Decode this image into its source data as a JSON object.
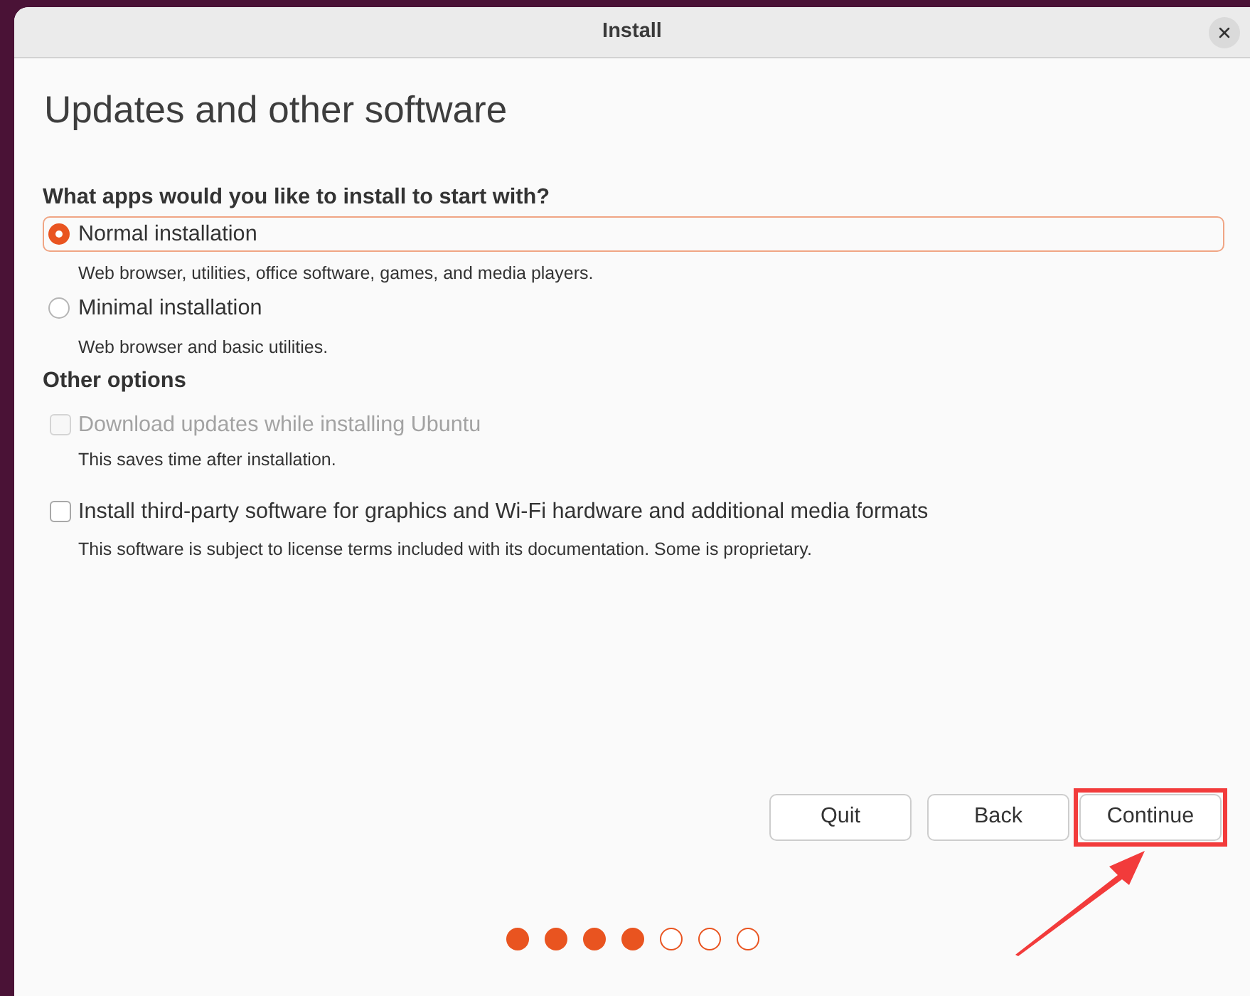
{
  "window": {
    "title": "Install"
  },
  "page": {
    "heading": "Updates and other software"
  },
  "install_type": {
    "question": "What apps would you like to install to start with?",
    "options": [
      {
        "label": "Normal installation",
        "description": "Web browser, utilities, office software, games, and media players.",
        "selected": true,
        "focused": true
      },
      {
        "label": "Minimal installation",
        "description": "Web browser and basic utilities.",
        "selected": false,
        "focused": false
      }
    ]
  },
  "other_options": {
    "heading": "Other options",
    "items": [
      {
        "label": "Download updates while installing Ubuntu",
        "description": "This saves time after installation.",
        "checked": false,
        "disabled": true
      },
      {
        "label": "Install third-party software for graphics and Wi-Fi hardware and additional media formats",
        "description": "This software is subject to license terms included with its documentation. Some is proprietary.",
        "checked": false,
        "disabled": false
      }
    ]
  },
  "buttons": [
    {
      "label": "Quit",
      "highlighted": false
    },
    {
      "label": "Back",
      "highlighted": false
    },
    {
      "label": "Continue",
      "highlighted": true
    }
  ],
  "progress_steps": [
    {
      "done": true
    },
    {
      "done": true
    },
    {
      "done": true
    },
    {
      "done": true
    },
    {
      "done": false
    },
    {
      "done": false
    },
    {
      "done": false
    }
  ]
}
